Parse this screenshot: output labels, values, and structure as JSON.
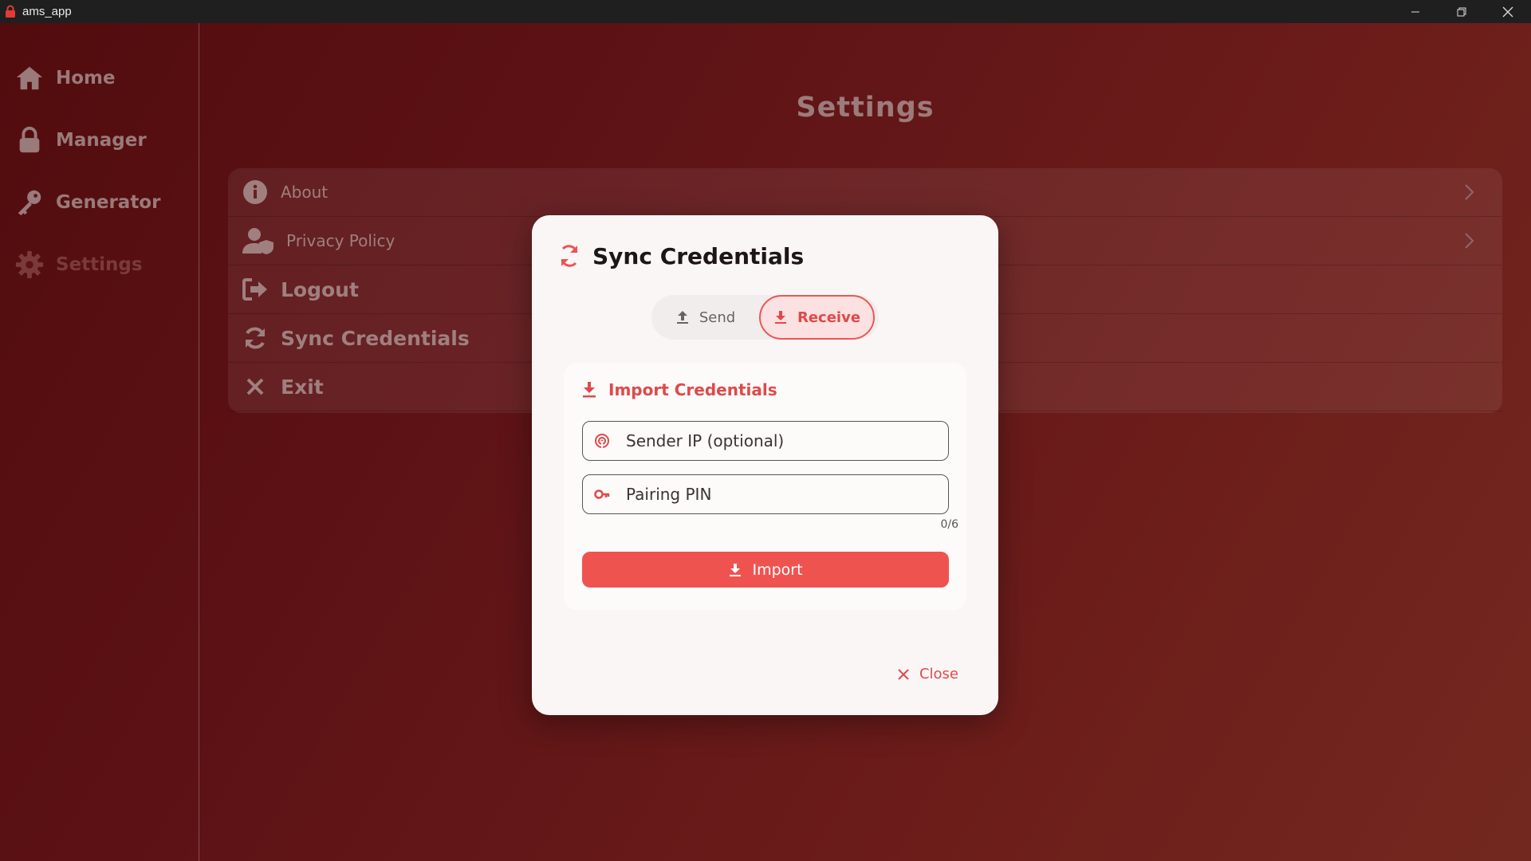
{
  "window": {
    "title": "ams_app"
  },
  "sidebar": {
    "items": [
      {
        "label": "Home",
        "icon": "home-icon"
      },
      {
        "label": "Manager",
        "icon": "lock-icon"
      },
      {
        "label": "Generator",
        "icon": "key-icon"
      },
      {
        "label": "Settings",
        "icon": "gear-icon",
        "active": true
      }
    ]
  },
  "page": {
    "title": "Settings"
  },
  "settings": {
    "items": [
      {
        "label": "About",
        "icon": "info-icon"
      },
      {
        "label": "Privacy Policy",
        "icon": "user-shield-icon"
      },
      {
        "label": "Logout",
        "icon": "logout-icon"
      },
      {
        "label": "Sync Credentials",
        "icon": "sync-icon"
      },
      {
        "label": "Exit",
        "icon": "close-icon"
      }
    ]
  },
  "dialog": {
    "title": "Sync Credentials",
    "tabs": {
      "send": "Send",
      "receive": "Receive",
      "selected": "Receive"
    },
    "section_title": "Import Credentials",
    "sender_ip": {
      "placeholder": "Sender IP (optional)",
      "value": ""
    },
    "pin": {
      "placeholder": "Pairing PIN",
      "value": "",
      "counter": "0/6"
    },
    "import_label": "Import",
    "close_label": "Close"
  },
  "colors": {
    "accent": "#ef5350",
    "accent_text": "#e04949",
    "dialog_bg": "#fbf6f6"
  }
}
